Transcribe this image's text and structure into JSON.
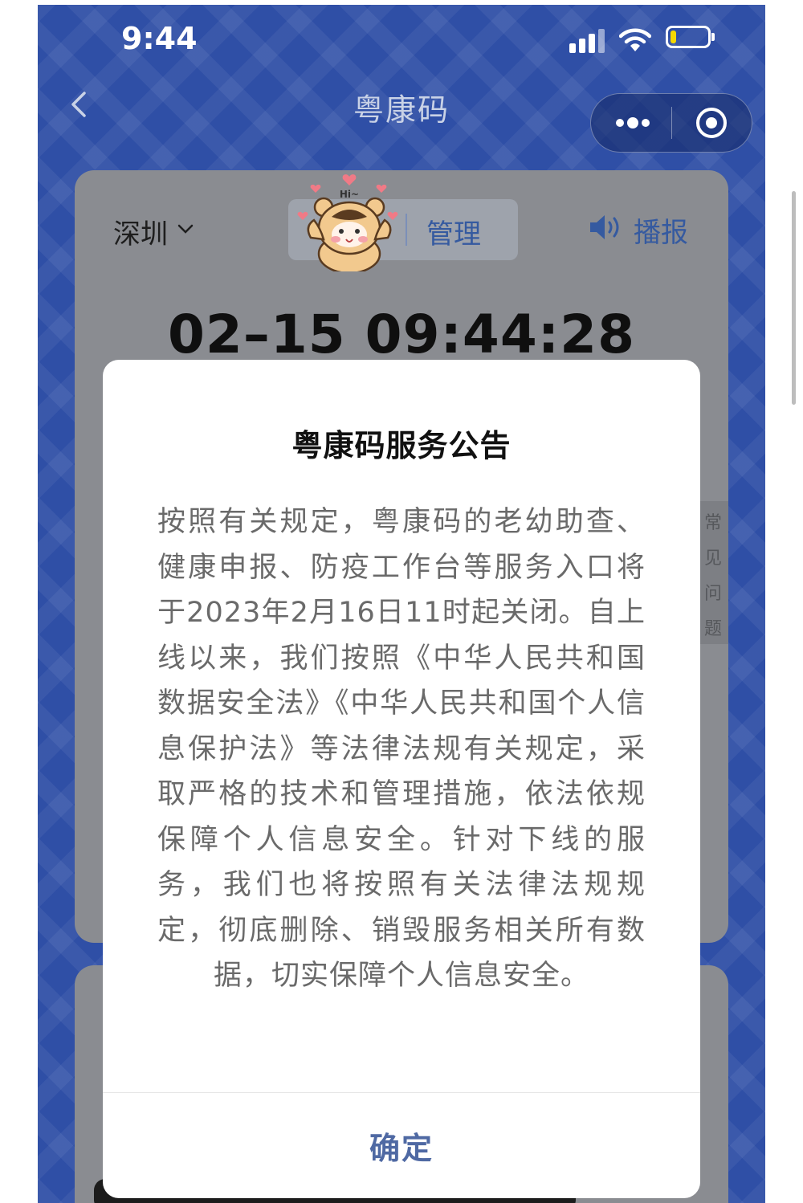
{
  "status_bar": {
    "time": "9:44",
    "signal_icon": "cellular-signal-icon",
    "wifi_icon": "wifi-icon",
    "battery_icon": "battery-low-icon",
    "battery_level": 0.15,
    "battery_color": "#f5d800"
  },
  "nav": {
    "back_icon": "chevron-left-icon",
    "title": "粤康码",
    "more_icon": "more-dots-icon",
    "close_icon": "mini-program-close-icon"
  },
  "main_card": {
    "city": "深圳",
    "city_chevron_icon": "chevron-down-icon",
    "segment_label": "管理",
    "broadcast_icon": "speaker-icon",
    "broadcast_label": "播报",
    "datetime": "02–15 09:44:28",
    "faq_tab": "常见问题"
  },
  "modal": {
    "title": "粤康码服务公告",
    "body": "按照有关规定，粤康码的老幼助查、健康申报、防疫工作台等服务入口将于2023年2月16日11时起关闭。自上线以来，我们按照《中华人民共和国数据安全法》《中华人民共和国个人信息保护法》等法律法规有关规定，采取严格的技术和管理措施，依法依规保障个人信息安全。针对下线的服务，我们也将按照有关法律法规规定，彻底删除、销毁服务相关所有数据，切实保障个人信息安全。",
    "confirm_label": "确定"
  },
  "sticker": {
    "text": "Hi~",
    "icon": "bear-mascot-sticker-icon"
  },
  "colors": {
    "background_blue": "#2f4fa6",
    "accent_blue": "#355aa0",
    "confirm_blue": "#4f69a3"
  }
}
